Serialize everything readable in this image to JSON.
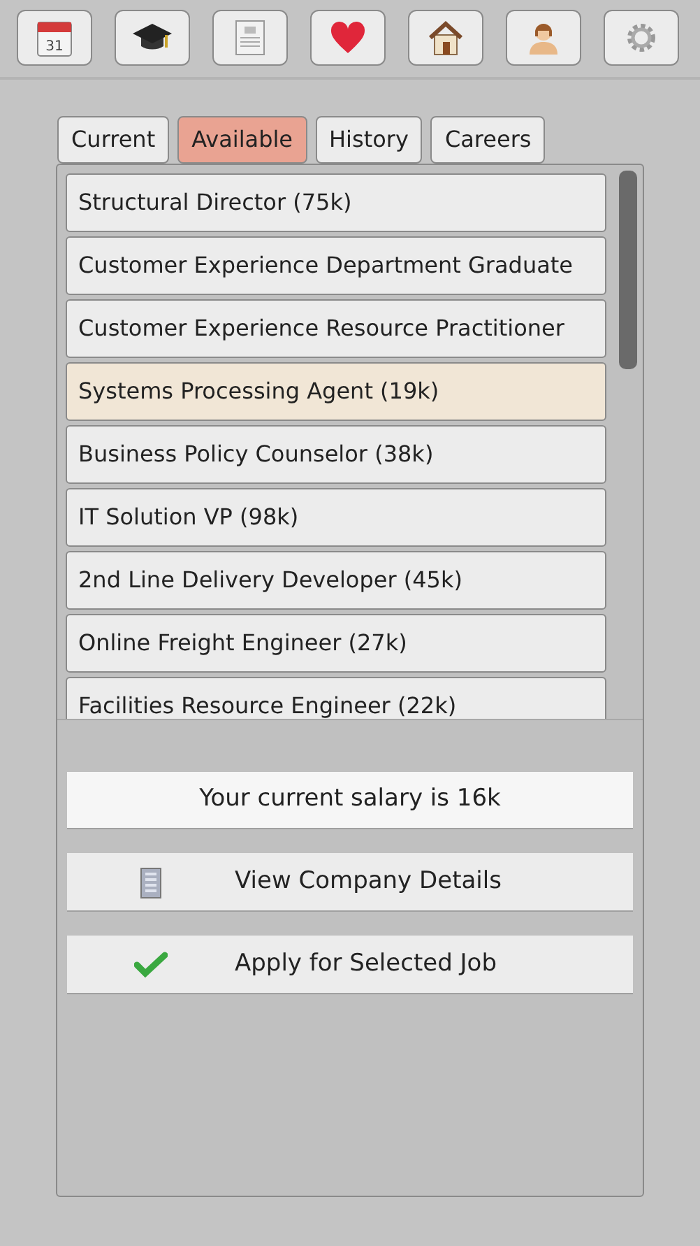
{
  "toolbar": [
    {
      "kind": "calendar",
      "text": "31"
    },
    {
      "kind": "cap"
    },
    {
      "kind": "document"
    },
    {
      "kind": "heart"
    },
    {
      "kind": "house"
    },
    {
      "kind": "person"
    },
    {
      "kind": "gear"
    }
  ],
  "tabs": [
    {
      "label": "Current",
      "selected": false
    },
    {
      "label": "Available",
      "selected": true
    },
    {
      "label": "History",
      "selected": false
    },
    {
      "label": "Careers",
      "selected": false
    }
  ],
  "jobs": [
    {
      "title": "Structural Director (75k)",
      "selected": false
    },
    {
      "title": "Customer Experience Department Graduate",
      "selected": false
    },
    {
      "title": "Customer Experience Resource Practitioner",
      "selected": false
    },
    {
      "title": "Systems Processing Agent (19k)",
      "selected": true
    },
    {
      "title": "Business Policy Counselor (38k)",
      "selected": false
    },
    {
      "title": "IT Solution VP (98k)",
      "selected": false
    },
    {
      "title": "2nd Line Delivery Developer (45k)",
      "selected": false
    },
    {
      "title": "Online Freight Engineer (27k)",
      "selected": false
    },
    {
      "title": "Facilities Resource Engineer (22k)",
      "selected": false
    }
  ],
  "salary": "Your current salary is 16k",
  "actions": [
    {
      "kind": "building",
      "label": "View Company Details"
    },
    {
      "kind": "check",
      "label": "Apply for Selected Job"
    }
  ]
}
